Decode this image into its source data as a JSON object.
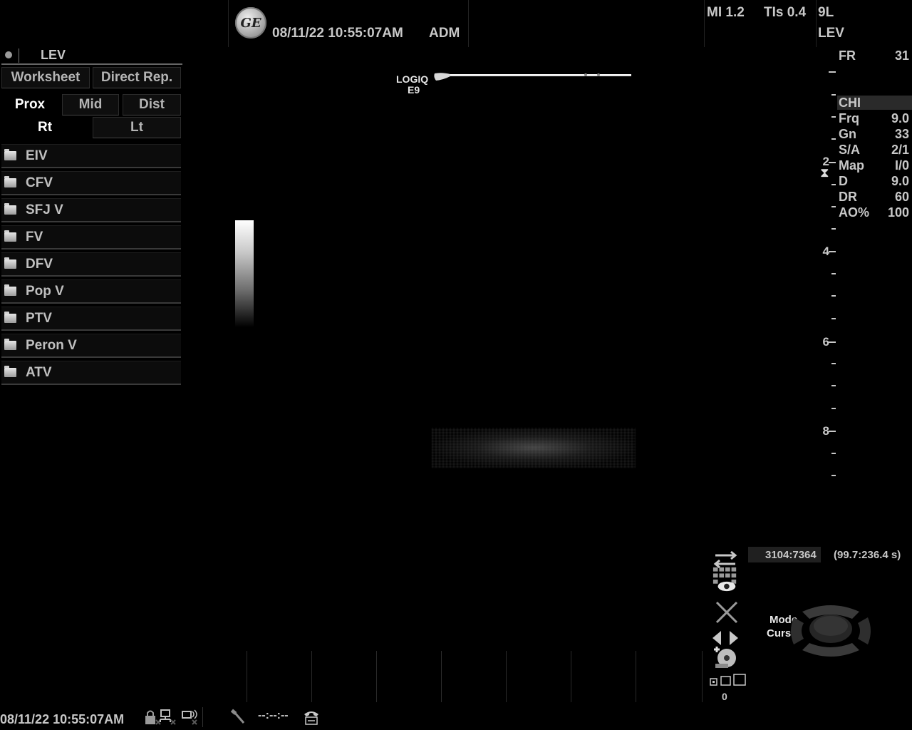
{
  "header": {
    "logo": "GE",
    "datetime": "08/11/22 10:55:07AM",
    "user": "ADM",
    "mi": "MI 1.2",
    "tis": "TIs 0.4",
    "probe": "9L",
    "preset": "LEV"
  },
  "worksheet": {
    "title": "LEV",
    "tabs": [
      "Worksheet",
      "Direct Rep."
    ],
    "location_tabs": [
      "Prox",
      "Mid",
      "Dist"
    ],
    "location_selected": "Prox",
    "side_tabs": [
      "Rt",
      "Lt"
    ],
    "side_selected": "Rt",
    "folders": [
      "EIV",
      "CFV",
      "SFJ V",
      "FV",
      "DFV",
      "Pop V",
      "PTV",
      "Peron V",
      "ATV"
    ]
  },
  "image": {
    "system_logo_line1": "LOGIQ",
    "system_logo_line2": "E9",
    "depth_labels": [
      "2",
      "4",
      "6",
      "8"
    ]
  },
  "params": [
    {
      "name": "FR",
      "value": "31"
    },
    {
      "name": "CHI",
      "value": ""
    },
    {
      "name": "Frq",
      "value": "9.0"
    },
    {
      "name": "Gn",
      "value": "33"
    },
    {
      "name": "S/A",
      "value": "2/1"
    },
    {
      "name": "Map",
      "value": "I/0"
    },
    {
      "name": "D",
      "value": "9.0"
    },
    {
      "name": "DR",
      "value": "60"
    },
    {
      "name": "AO%",
      "value": "100"
    }
  ],
  "cine": {
    "frame": "3104:7364",
    "time": "(99.7:236.4 s)"
  },
  "trackball": {
    "line1": "Mode",
    "line2": "Cursor"
  },
  "layout_count": "0",
  "status": {
    "datetime": "08/11/22 10:55:07AM",
    "cine_readout": "--:--:--"
  },
  "icons": [
    "ge-logo-icon",
    "swap-arrows-icon",
    "keyboard-eye-icon",
    "close-x-icon",
    "left-right-arrows-icon",
    "disc-save-icon",
    "layout-icon",
    "lock-icon",
    "network-icon",
    "wireless-icon",
    "tool-icon",
    "phone-icon"
  ]
}
